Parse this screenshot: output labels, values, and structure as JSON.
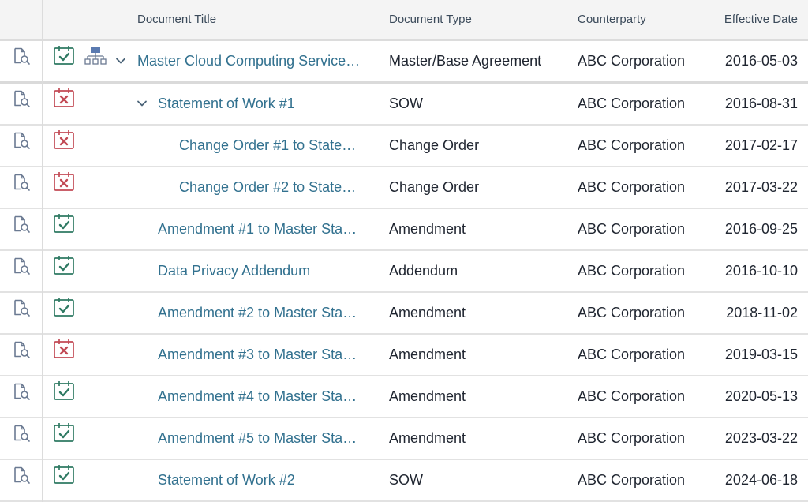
{
  "colors": {
    "link": "#32718f",
    "ok": "#2f7a63",
    "error": "#c24a55",
    "icon_gray": "#6b7a92",
    "hierarchy": "#5a7ab0"
  },
  "columns": {
    "title": "Document Title",
    "type": "Document Type",
    "counterparty": "Counterparty",
    "effective_date": "Effective Date"
  },
  "rows": [
    {
      "title": "Master Cloud Computing Service…",
      "type": "Master/Base Agreement",
      "counterparty": "ABC Corporation",
      "effective_date": "2016-05-03",
      "status": "valid",
      "level": 0,
      "expanded": true,
      "hierarchy_icon": true
    },
    {
      "title": "Statement of Work #1",
      "type": "SOW",
      "counterparty": "ABC Corporation",
      "effective_date": "2016-08-31",
      "status": "invalid",
      "level": 1,
      "expanded": true
    },
    {
      "title": "Change Order #1 to State…",
      "type": "Change Order",
      "counterparty": "ABC Corporation",
      "effective_date": "2017-02-17",
      "status": "invalid",
      "level": 2
    },
    {
      "title": "Change Order #2 to State…",
      "type": "Change Order",
      "counterparty": "ABC Corporation",
      "effective_date": "2017-03-22",
      "status": "invalid",
      "level": 2
    },
    {
      "title": "Amendment #1 to Master Sta…",
      "type": "Amendment",
      "counterparty": "ABC Corporation",
      "effective_date": "2016-09-25",
      "status": "valid",
      "level": 1
    },
    {
      "title": "Data Privacy Addendum",
      "type": "Addendum",
      "counterparty": "ABC Corporation",
      "effective_date": "2016-10-10",
      "status": "valid",
      "level": 1
    },
    {
      "title": "Amendment #2 to Master Sta…",
      "type": "Amendment",
      "counterparty": "ABC Corporation",
      "effective_date": "2018-11-02",
      "status": "valid",
      "level": 1
    },
    {
      "title": "Amendment #3 to Master Sta…",
      "type": "Amendment",
      "counterparty": "ABC Corporation",
      "effective_date": "2019-03-15",
      "status": "invalid",
      "level": 1
    },
    {
      "title": "Amendment #4 to Master Sta…",
      "type": "Amendment",
      "counterparty": "ABC Corporation",
      "effective_date": "2020-05-13",
      "status": "valid",
      "level": 1
    },
    {
      "title": "Amendment #5 to Master Sta…",
      "type": "Amendment",
      "counterparty": "ABC Corporation",
      "effective_date": "2023-03-22",
      "status": "valid",
      "level": 1
    },
    {
      "title": "Statement of Work #2",
      "type": "SOW",
      "counterparty": "ABC Corporation",
      "effective_date": "2024-06-18",
      "status": "valid",
      "level": 1
    }
  ]
}
